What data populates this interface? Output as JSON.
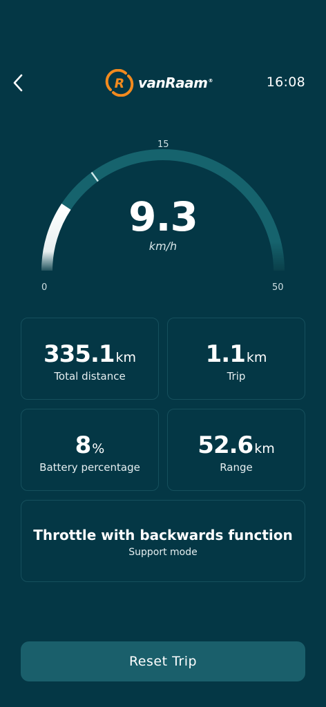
{
  "header": {
    "back_icon": "chevron-left-icon",
    "brand": "vanRaam",
    "brand_reg": "®",
    "brand_color": "#f28a1e",
    "time": "16:08"
  },
  "gauge": {
    "speed": "9.3",
    "unit": "km/h",
    "min_label": "0",
    "mid_label": "15",
    "max_label": "50",
    "min": 0,
    "max": 50,
    "marker_value": 15,
    "current_value": 9.3,
    "track_color": "#16636d",
    "fill_color": "#ffffff"
  },
  "stats": [
    {
      "value": "335.1",
      "unit": "km",
      "label": "Total distance"
    },
    {
      "value": "1.1",
      "unit": "km",
      "label": "Trip"
    },
    {
      "value": "8",
      "unit": "%",
      "label": "Battery percentage"
    },
    {
      "value": "52.6",
      "unit": "km",
      "label": "Range"
    }
  ],
  "mode": {
    "title": "Throttle with backwards function",
    "label": "Support mode"
  },
  "actions": {
    "reset_label": "Reset Trip"
  }
}
